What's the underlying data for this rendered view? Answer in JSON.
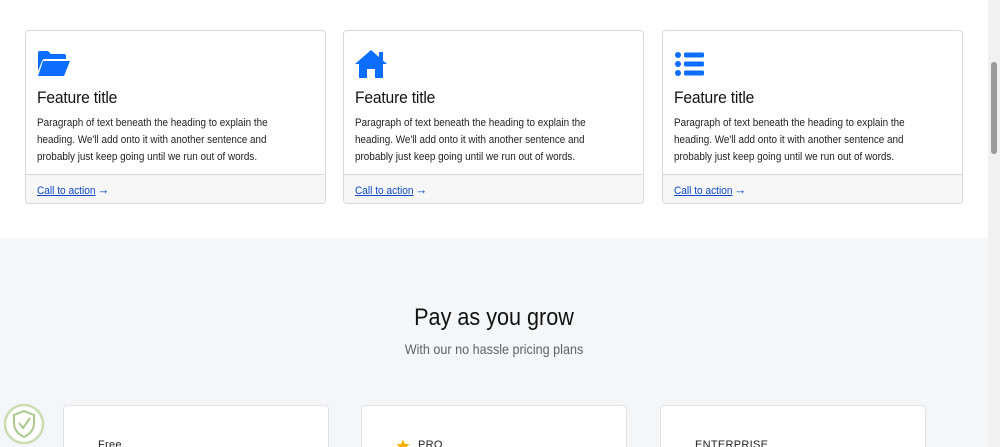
{
  "features": [
    {
      "icon": "folder-open-icon",
      "title": "Feature title",
      "text": "Paragraph of text beneath the heading to explain the heading. We'll add onto it with another sentence and probably just keep going until we run out of words.",
      "cta": "Call to action"
    },
    {
      "icon": "home-icon",
      "title": "Feature title",
      "text": "Paragraph of text beneath the heading to explain the heading. We'll add onto it with another sentence and probably just keep going until we run out of words.",
      "cta": "Call to action"
    },
    {
      "icon": "list-icon",
      "title": "Feature title",
      "text": "Paragraph of text beneath the heading to explain the heading. We'll add onto it with another sentence and probably just keep going until we run out of words.",
      "cta": "Call to action"
    }
  ],
  "pricing": {
    "title": "Pay as you grow",
    "subtitle": "With our no hassle pricing plans",
    "plans": [
      {
        "name": "Free"
      },
      {
        "name": "PRO",
        "icon": "star-icon"
      },
      {
        "name": "ENTERPRISE"
      }
    ]
  },
  "colors": {
    "accent": "#0d6efd",
    "link": "#0d47c4",
    "star": "#f4b400",
    "section_bg": "#f5f6f7"
  }
}
